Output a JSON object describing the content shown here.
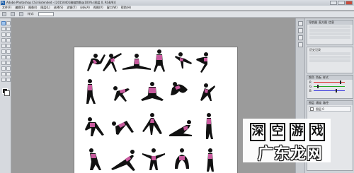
{
  "window": {
    "title": "Adobe Photoshop CS3 Extended - [20150401瑜伽剪影@100% (图层 0, RGB/8)]",
    "app_icon_text": "Ps"
  },
  "menu": [
    "文件(F)",
    "编辑(E)",
    "图像(I)",
    "图层(L)",
    "选择(S)",
    "滤镜(T)",
    "分析(A)",
    "视图(V)",
    "窗口(W)",
    "帮助(H)"
  ],
  "options_bar": {
    "label": "样式:",
    "value": "正常"
  },
  "panels": {
    "nav_tabs": [
      "导航器",
      "直方图",
      "信息"
    ],
    "history_text": "历史记录",
    "swatch_tabs": [
      "颜色",
      "色板",
      "样式"
    ],
    "layers_tabs": [
      "图层",
      "通道",
      "路径"
    ],
    "layer_name": "图层 0",
    "sliders": [
      {
        "label": "R",
        "value": 0.72
      },
      {
        "label": "G",
        "value": 0.1
      },
      {
        "label": "B",
        "value": 0.6
      }
    ]
  },
  "colors": {
    "silhouette": "#111111",
    "accent": "#c85a9e"
  },
  "watermark": {
    "chars": [
      "深",
      "空",
      "游",
      "戏"
    ],
    "brand": "广东龙网"
  }
}
